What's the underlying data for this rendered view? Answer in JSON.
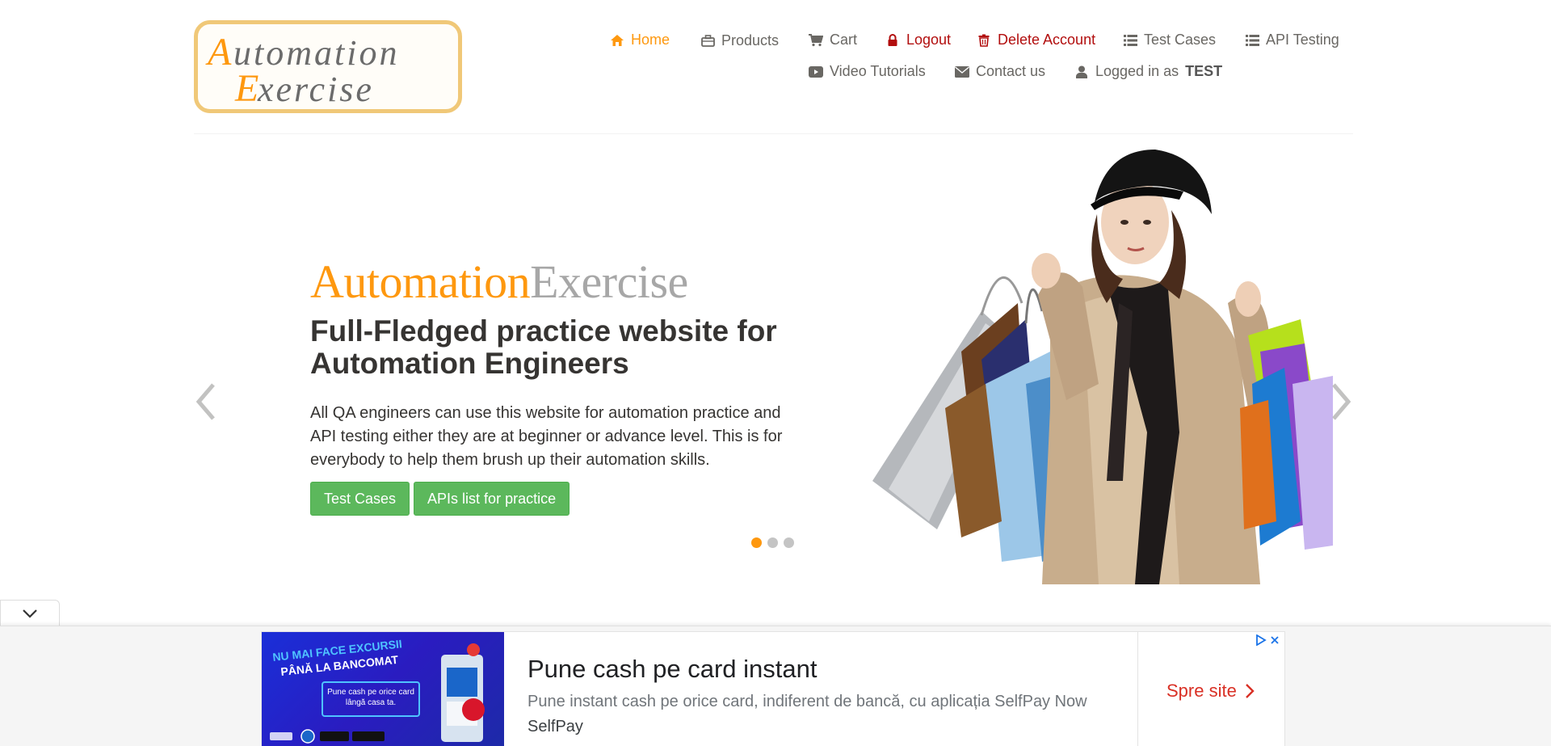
{
  "logo": {
    "line1": "Automation",
    "line2": "Exercise"
  },
  "nav": {
    "home": "Home",
    "products": "Products",
    "cart": "Cart",
    "logout": "Logout",
    "delete_account": "Delete Account",
    "test_cases": "Test Cases",
    "api_testing": "API Testing",
    "video_tutorials": "Video Tutorials",
    "contact_us": "Contact us",
    "logged_in_prefix": "Logged in as",
    "logged_in_user": "TEST"
  },
  "slider": {
    "brand_part1": "Automation",
    "brand_part2": "Exercise",
    "headline": "Full-Fledged practice website for Automation Engineers",
    "description": "All QA engineers can use this website for automation practice and API testing either they are at beginner or advance level. This is for everybody to help them brush up their automation skills.",
    "btn_test_cases": "Test Cases",
    "btn_apis": "APIs list for practice",
    "active_slide": 1,
    "slide_count": 3
  },
  "ad": {
    "image_line1": "NU MAI FACE EXCURSII",
    "image_line2": "PÂNĂ LA BANCOMAT",
    "image_box": "Pune cash pe orice card lângă casa ta.",
    "title": "Pune cash pe card instant",
    "text": "Pune instant cash pe orice card, indiferent de bancă, cu aplicația SelfPay Now",
    "brand": "SelfPay",
    "cta": "Spre site"
  },
  "colors": {
    "accent": "#FE980F",
    "danger": "#b20e0e",
    "button_green": "#5cb85c",
    "ad_cta": "#d93025"
  }
}
